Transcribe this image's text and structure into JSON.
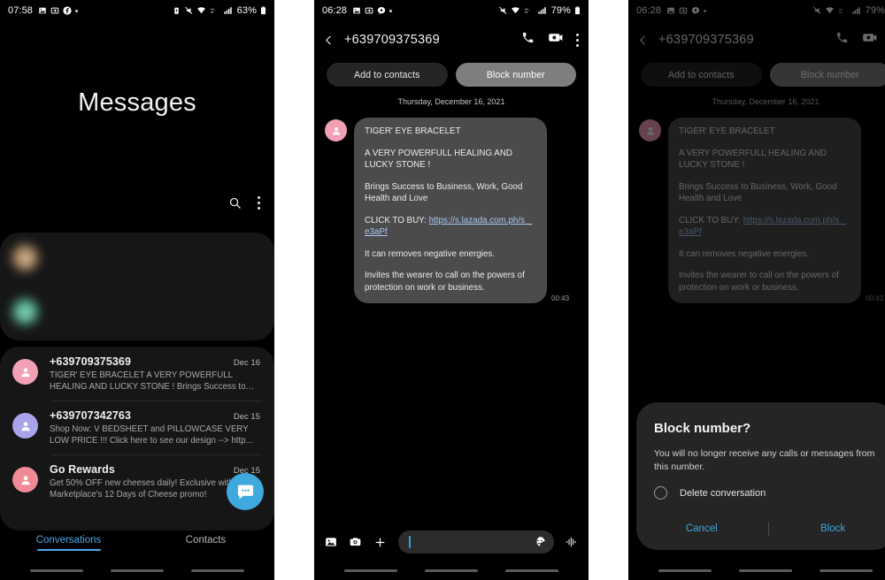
{
  "panel1": {
    "statusbar": {
      "time": "07:58",
      "left_icons": [
        "gallery-icon",
        "forward-icon",
        "facebook-icon",
        "dot-icon"
      ],
      "right_icons": [
        "battery-saver-icon",
        "mute-icon",
        "wifi-icon",
        "volte-icon",
        "signal-icon"
      ],
      "battery": "63%"
    },
    "title": "Messages",
    "actions": {
      "search": "search-icon",
      "more": "more-options-icon"
    },
    "conversations": [
      {
        "name": "",
        "date": "",
        "snippet": "",
        "avatar_color": "#c8a070",
        "blurred": true
      },
      {
        "name": "",
        "date": "",
        "snippet": "",
        "avatar_color": "#5fcaa8",
        "blurred": true
      },
      {
        "name": "+639709375369",
        "date": "Dec 16",
        "snippet": "TIGER' EYE BRACELET  A VERY POWERFULL HEALING AND LUCKY STONE !  Brings Success to B...",
        "avatar_color": "#f2a0b6",
        "blurred": false
      },
      {
        "name": "+639707342763",
        "date": "Dec 15",
        "snippet": "Shop Now: V BEDSHEET and PILLOWCASE  VERY LOW PRICE !!!  Click here to see our design --> http...",
        "avatar_color": "#a8a3ea",
        "blurred": false
      },
      {
        "name": "Go Rewards",
        "date": "Dec 15",
        "snippet": "Get 50% OFF new cheeses daily! Exclusive with The Marketplace's 12 Days of Cheese promo!",
        "avatar_color": "#ef8a96",
        "blurred": false
      }
    ],
    "fab": {
      "name": "new-conversation-fab",
      "color": "#3fa9dd",
      "icon": "chat-bubble-icon"
    },
    "tabs": [
      {
        "label": "Conversations",
        "active": true
      },
      {
        "label": "Contacts",
        "active": false
      }
    ],
    "accent": "#4aa8e8"
  },
  "panel2": {
    "statusbar": {
      "time": "06:28",
      "left_icons": [
        "gallery-icon",
        "forward-icon",
        "chat-icon",
        "dot-icon"
      ],
      "right_icons": [
        "mute-icon",
        "wifi-icon",
        "volte-icon",
        "signal-icon"
      ],
      "battery": "79%"
    },
    "header": {
      "back": "back-arrow-icon",
      "title": "+639709375369",
      "call": "phone-call-icon",
      "video": "video-call-icon",
      "more": "more-options-icon"
    },
    "quick_buttons": [
      {
        "label": "Add to contacts",
        "pressed": false
      },
      {
        "label": "Block number",
        "pressed": true
      }
    ],
    "date_separator": "Thursday, December 16, 2021",
    "message": {
      "avatar_color": "#f2a0b6",
      "line1": "TIGER' EYE BRACELET",
      "line2": "A VERY POWERFULL HEALING AND LUCKY STONE !",
      "line3": "Brings Success to Business, Work, Good Health and Love",
      "line4_prefix": "CLICK TO BUY: ",
      "link": "https://s.lazada.com.ph/s _e3aPf",
      "line5": "It can removes negative energies.",
      "line6": "Invites the wearer to call on the powers of protection on work or business.",
      "time": "00:43"
    },
    "composer": {
      "gallery": "image-icon",
      "camera": "camera-icon",
      "plus": "add-icon",
      "placeholder": "",
      "value": "",
      "sticker": "sticker-icon",
      "audio": "voice-waveform-icon"
    }
  },
  "panel3": {
    "dialog": {
      "title": "Block number?",
      "body": "You will no longer receive any calls or messages from this number.",
      "checkbox_label": "Delete conversation",
      "checkbox_checked": false,
      "cancel": "Cancel",
      "confirm": "Block",
      "accent": "#3ea6e0"
    }
  }
}
